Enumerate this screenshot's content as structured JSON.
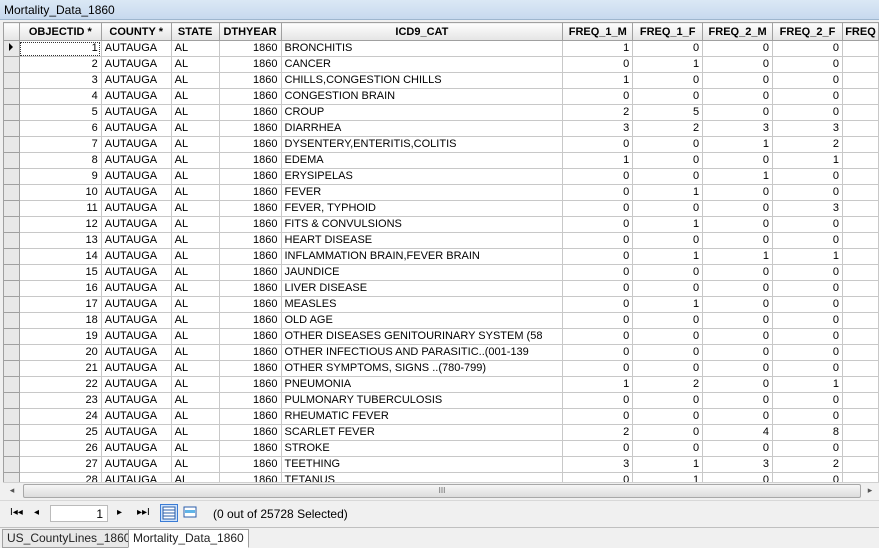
{
  "window": {
    "title": "Mortality_Data_1860"
  },
  "columns": [
    "",
    "OBJECTID *",
    "COUNTY *",
    "STATE",
    "DTHYEAR",
    "ICD9_CAT",
    "FREQ_1_M",
    "FREQ_1_F",
    "FREQ_2_M",
    "FREQ_2_F",
    "FREQ"
  ],
  "rows": [
    [
      "1",
      "AUTAUGA",
      "AL",
      "1860",
      "BRONCHITIS",
      "1",
      "0",
      "0",
      "0"
    ],
    [
      "2",
      "AUTAUGA",
      "AL",
      "1860",
      "CANCER",
      "0",
      "1",
      "0",
      "0"
    ],
    [
      "3",
      "AUTAUGA",
      "AL",
      "1860",
      "CHILLS,CONGESTION CHILLS",
      "1",
      "0",
      "0",
      "0"
    ],
    [
      "4",
      "AUTAUGA",
      "AL",
      "1860",
      "CONGESTION BRAIN",
      "0",
      "0",
      "0",
      "0"
    ],
    [
      "5",
      "AUTAUGA",
      "AL",
      "1860",
      "CROUP",
      "2",
      "5",
      "0",
      "0"
    ],
    [
      "6",
      "AUTAUGA",
      "AL",
      "1860",
      "DIARRHEA",
      "3",
      "2",
      "3",
      "3"
    ],
    [
      "7",
      "AUTAUGA",
      "AL",
      "1860",
      "DYSENTERY,ENTERITIS,COLITIS",
      "0",
      "0",
      "1",
      "2"
    ],
    [
      "8",
      "AUTAUGA",
      "AL",
      "1860",
      "EDEMA",
      "1",
      "0",
      "0",
      "1"
    ],
    [
      "9",
      "AUTAUGA",
      "AL",
      "1860",
      "ERYSIPELAS",
      "0",
      "0",
      "1",
      "0"
    ],
    [
      "10",
      "AUTAUGA",
      "AL",
      "1860",
      "FEVER",
      "0",
      "1",
      "0",
      "0"
    ],
    [
      "11",
      "AUTAUGA",
      "AL",
      "1860",
      "FEVER, TYPHOID",
      "0",
      "0",
      "0",
      "3"
    ],
    [
      "12",
      "AUTAUGA",
      "AL",
      "1860",
      "FITS &  CONVULSIONS",
      "0",
      "1",
      "0",
      "0"
    ],
    [
      "13",
      "AUTAUGA",
      "AL",
      "1860",
      "HEART DISEASE",
      "0",
      "0",
      "0",
      "0"
    ],
    [
      "14",
      "AUTAUGA",
      "AL",
      "1860",
      "INFLAMMATION BRAIN,FEVER BRAIN",
      "0",
      "1",
      "1",
      "1"
    ],
    [
      "15",
      "AUTAUGA",
      "AL",
      "1860",
      "JAUNDICE",
      "0",
      "0",
      "0",
      "0"
    ],
    [
      "16",
      "AUTAUGA",
      "AL",
      "1860",
      "LIVER DISEASE",
      "0",
      "0",
      "0",
      "0"
    ],
    [
      "17",
      "AUTAUGA",
      "AL",
      "1860",
      "MEASLES",
      "0",
      "1",
      "0",
      "0"
    ],
    [
      "18",
      "AUTAUGA",
      "AL",
      "1860",
      "OLD AGE",
      "0",
      "0",
      "0",
      "0"
    ],
    [
      "19",
      "AUTAUGA",
      "AL",
      "1860",
      "OTHER DISEASES  GENITOURINARY SYSTEM (58",
      "0",
      "0",
      "0",
      "0"
    ],
    [
      "20",
      "AUTAUGA",
      "AL",
      "1860",
      "OTHER INFECTIOUS AND PARASITIC..(001-139",
      "0",
      "0",
      "0",
      "0"
    ],
    [
      "21",
      "AUTAUGA",
      "AL",
      "1860",
      "OTHER SYMPTOMS, SIGNS ..(780-799)",
      "0",
      "0",
      "0",
      "0"
    ],
    [
      "22",
      "AUTAUGA",
      "AL",
      "1860",
      "PNEUMONIA",
      "1",
      "2",
      "0",
      "1"
    ],
    [
      "23",
      "AUTAUGA",
      "AL",
      "1860",
      "PULMONARY TUBERCULOSIS",
      "0",
      "0",
      "0",
      "0"
    ],
    [
      "24",
      "AUTAUGA",
      "AL",
      "1860",
      "RHEUMATIC FEVER",
      "0",
      "0",
      "0",
      "0"
    ],
    [
      "25",
      "AUTAUGA",
      "AL",
      "1860",
      "SCARLET FEVER",
      "2",
      "0",
      "4",
      "8"
    ],
    [
      "26",
      "AUTAUGA",
      "AL",
      "1860",
      "STROKE",
      "0",
      "0",
      "0",
      "0"
    ],
    [
      "27",
      "AUTAUGA",
      "AL",
      "1860",
      "TEETHING",
      "3",
      "1",
      "3",
      "2"
    ],
    [
      "28",
      "AUTAUGA",
      "AL",
      "1860",
      "TETANUS",
      "0",
      "1",
      "0",
      "0"
    ]
  ],
  "hscroll": {
    "left_arrow": "◂",
    "right_arrow": "▸",
    "grip": "III"
  },
  "nav": {
    "first": "I◂◂",
    "prev": "◂",
    "record": "1",
    "next": "▸",
    "last": "▸▸I",
    "selection_info": "(0 out of 25728 Selected)"
  },
  "tabs": [
    "US_CountyLines_1860",
    "Mortality_Data_1860"
  ],
  "icons": {
    "view_all": "show-all-records-icon",
    "view_selected": "show-selected-records-icon"
  }
}
